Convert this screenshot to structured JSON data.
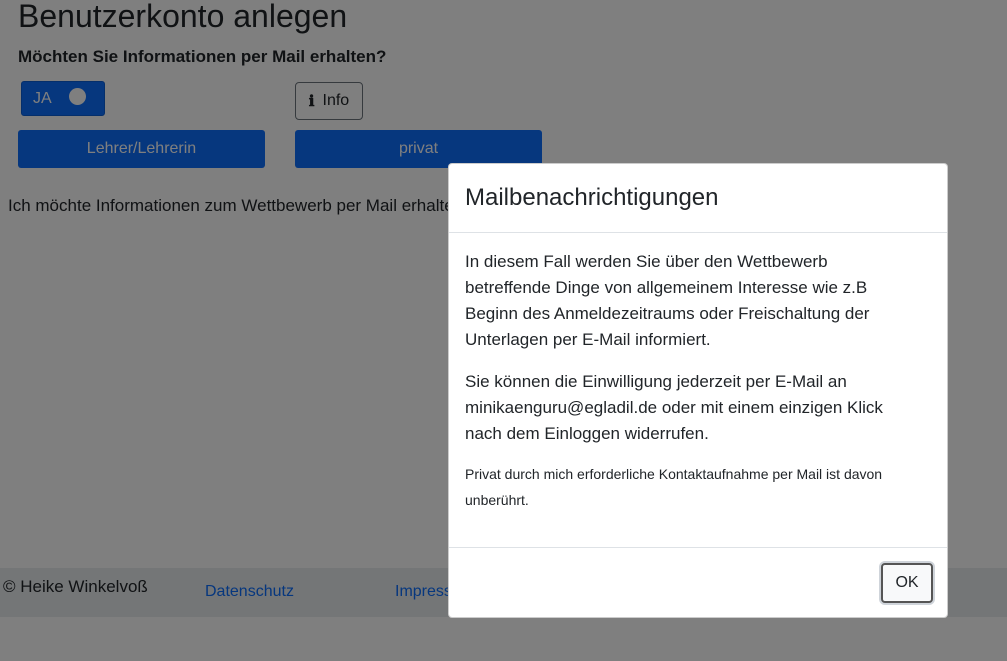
{
  "page": {
    "title": "Benutzerkonto anlegen",
    "question": "Möchten Sie Informationen per Mail erhalten?",
    "toggle_label": "JA",
    "info_button": {
      "icon": "info-icon",
      "label": "Info"
    },
    "role_buttons": [
      "Lehrer/Lehrerin",
      "privat"
    ],
    "consent_text": "Ich möchte Informationen zum Wettbewerb per Mail erhalten."
  },
  "footer": {
    "copyright": "© Heike Winkelvoß",
    "links": [
      "Datenschutz",
      "Impressum"
    ]
  },
  "modal": {
    "title": "Mailbenachrichtigungen",
    "paragraphs": [
      "In diesem Fall werden Sie über den Wettbewerb betreffende Dinge von allgemeinem Interesse wie z.B Beginn des Anmeldezeitraums oder Freischaltung der Unterlagen per E-Mail informiert.",
      "Sie können die Einwilligung jederzeit per E-Mail an minikaenguru@egladil.de oder mit einem einzigen Klick nach dem Einloggen widerrufen."
    ],
    "note": "Privat durch mich erforderliche Kontaktaufnahme per Mail ist davon unberührt.",
    "ok_label": "OK"
  },
  "colors": {
    "primary": "#0d6efd",
    "link": "#0d6efd",
    "footer_bg": "#e9ecef",
    "backdrop": "rgba(0,0,0,0.5)"
  }
}
